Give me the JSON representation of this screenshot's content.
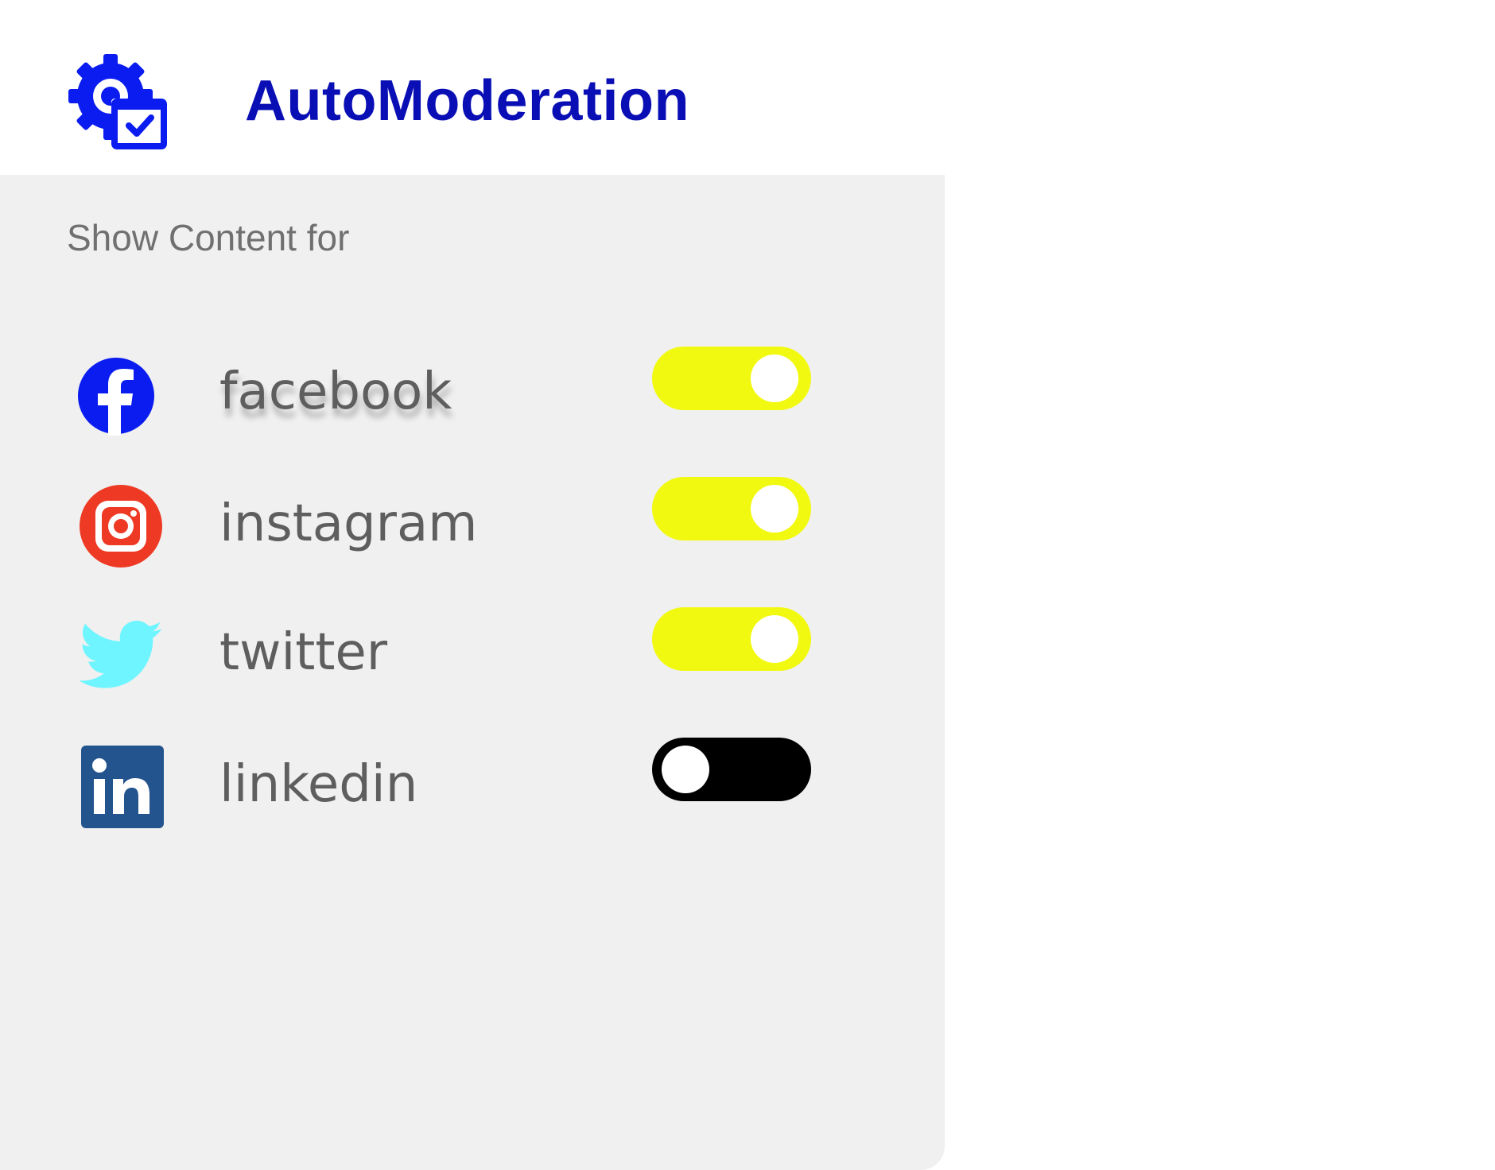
{
  "app": {
    "title": "AutoModeration",
    "icon": "gear-check-icon",
    "accent_color": "#0a0fb5"
  },
  "panel": {
    "section_label": "Show Content for",
    "networks": [
      {
        "label": "facebook",
        "icon": "facebook-icon",
        "enabled": true,
        "color": "#0a1cf0"
      },
      {
        "label": "instagram",
        "icon": "instagram-icon",
        "enabled": true,
        "color": "#ee3a24"
      },
      {
        "label": "twitter",
        "icon": "twitter-icon",
        "enabled": true,
        "color": "#6ef5ff"
      },
      {
        "label": "linkedin",
        "icon": "linkedin-icon",
        "enabled": false,
        "color": "#23548e"
      }
    ],
    "toggle_on_color": "#f2f910",
    "toggle_off_color": "#000000"
  }
}
